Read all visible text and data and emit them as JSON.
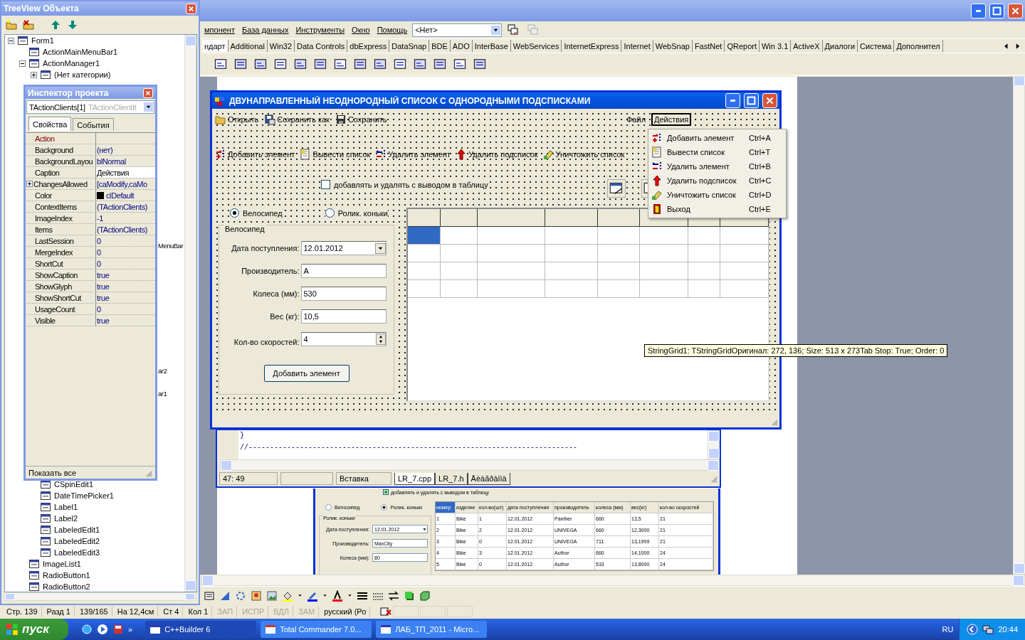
{
  "ide": {
    "menu": [
      "мпонент",
      "База данных",
      "Инструменты",
      "Окно",
      "Помощь"
    ],
    "target": "<Нет>",
    "palette_tabs": [
      {
        "label": "ндарт",
        "selected": true
      },
      {
        "label": "Additional",
        "selected": false
      },
      {
        "label": "Win32",
        "selected": false
      },
      {
        "label": "Data Controls",
        "selected": false
      },
      {
        "label": "dbExpress",
        "selected": false
      },
      {
        "label": "DataSnap",
        "selected": false
      },
      {
        "label": "BDE",
        "selected": false
      },
      {
        "label": "ADO",
        "selected": false
      },
      {
        "label": "InterBase",
        "selected": false
      },
      {
        "label": "WebServices",
        "selected": false
      },
      {
        "label": "InternetExpress",
        "selected": false
      },
      {
        "label": "Internet",
        "selected": false
      },
      {
        "label": "WebSnap",
        "selected": false
      },
      {
        "label": "FastNet",
        "selected": false
      },
      {
        "label": "QReport",
        "selected": false
      },
      {
        "label": "Win 3.1",
        "selected": false
      },
      {
        "label": "ActiveX",
        "selected": false
      },
      {
        "label": "Диалоги",
        "selected": false
      },
      {
        "label": "Система",
        "selected": false
      },
      {
        "label": "Дополнител",
        "selected": false
      }
    ]
  },
  "treeview": {
    "title": "TreeView Объекта",
    "items": [
      {
        "label": "Form1",
        "expanded": true,
        "children": [
          {
            "label": "ActionMainMenuBar1"
          },
          {
            "label": "ActionManager1",
            "expanded": true,
            "children": [
              {
                "label": "(Нет категории)",
                "expanded": false
              }
            ]
          },
          {
            "label": "MenuBar",
            "kind": "partial"
          },
          {
            "label": "ar2",
            "kind": "partial"
          },
          {
            "label": "ar1",
            "kind": "partial"
          },
          {
            "kind": "covered",
            "children": [
              {
                "label": "CSpinEdit1"
              },
              {
                "label": "DateTimePicker1"
              },
              {
                "label": "Label1"
              },
              {
                "label": "Label2"
              },
              {
                "label": "LabeledEdit1"
              },
              {
                "label": "LabeledEdit2"
              },
              {
                "label": "LabeledEdit3"
              }
            ]
          },
          {
            "label": "ImageList1"
          },
          {
            "label": "RadioButton1"
          },
          {
            "label": "RadioButton2"
          }
        ]
      }
    ]
  },
  "inspector": {
    "title": "Инспектор проекта",
    "object": "TActionClients[1]",
    "object_type": "TActionClientIt",
    "tabs": [
      {
        "label": "Свойства",
        "selected": true
      },
      {
        "label": "События",
        "selected": false
      }
    ],
    "properties": [
      {
        "name": "Action",
        "kind": "reference",
        "selected": false
      },
      {
        "name": "Background",
        "value": "(нет)",
        "kind": "plain",
        "selected": false
      },
      {
        "name": "BackgroundLayou",
        "value": "blNormal",
        "kind": "plain",
        "selected": false
      },
      {
        "name": "Caption",
        "value": "Действия",
        "kind": "plain",
        "selected": true
      },
      {
        "name": "ChangesAllowed",
        "value": "[caModify,caMo",
        "kind": "set",
        "selected": false
      },
      {
        "name": "Color",
        "value": "clDefault",
        "kind": "color",
        "selected": false
      },
      {
        "name": "ContextItems",
        "value": "(TActionClients)",
        "kind": "plain",
        "selected": false
      },
      {
        "name": "ImageIndex",
        "value": "-1",
        "kind": "plain",
        "selected": false
      },
      {
        "name": "Items",
        "value": "(TActionClients)",
        "kind": "plain",
        "selected": false
      },
      {
        "name": "LastSession",
        "value": "0",
        "kind": "plain",
        "selected": false
      },
      {
        "name": "MergeIndex",
        "value": "0",
        "kind": "plain",
        "selected": false
      },
      {
        "name": "ShortCut",
        "value": "0",
        "kind": "plain",
        "selected": false
      },
      {
        "name": "ShowCaption",
        "value": "true",
        "kind": "plain",
        "selected": false
      },
      {
        "name": "ShowGlyph",
        "value": "true",
        "kind": "plain",
        "selected": false
      },
      {
        "name": "ShowShortCut",
        "value": "true",
        "kind": "plain",
        "selected": false
      },
      {
        "name": "UsageCount",
        "value": "0",
        "kind": "plain",
        "selected": false
      },
      {
        "name": "Visible",
        "value": "true",
        "kind": "plain",
        "selected": false
      }
    ],
    "footer": "Показать все"
  },
  "editor": {
    "lines": [
      "}",
      "//-----------------------------------------------------------------------------"
    ],
    "position": "47:  49",
    "mode": "Вставка",
    "tabs": [
      {
        "label": "LR_7.cpp",
        "selected": true
      },
      {
        "label": "LR_7.h",
        "selected": false
      },
      {
        "label": "Äèàãðàììà",
        "selected": false
      }
    ]
  },
  "form": {
    "title": "ДВУНАПРАВЛЕННЫЙ  НЕОДНОРОДНЫЙ  СПИСОК  С  ОДНОРОДНЫМИ  ПОДСПИСКАМИ",
    "toolbar": [
      "Открыть",
      "Сохранить как",
      "Сохранить"
    ],
    "menus": [
      {
        "label": "Файл",
        "selected": false
      },
      {
        "label": "Действия",
        "selected": true
      }
    ],
    "actions": [
      "Добавить элемент",
      "Вывести список",
      "Удалить элемент",
      "Удалить подсписок",
      "Уничтожить список"
    ],
    "option": {
      "label": "добавлять и удалять с выводом в таблицу",
      "checked": false
    },
    "vehicles": [
      {
        "label": "Велосипед",
        "selected": true
      },
      {
        "label": "Ролик. коньки",
        "selected": false
      }
    ],
    "group": {
      "title": "Велосипед",
      "fields": [
        {
          "label": "Дата поступления:",
          "value": "12.01.2012",
          "kind": "date"
        },
        {
          "label": "Производитель:",
          "value": "A",
          "kind": "text"
        },
        {
          "label": "Колеса (мм):",
          "value": "530",
          "kind": "text"
        },
        {
          "label": "Вес (кг):",
          "value": "10,5",
          "kind": "text"
        },
        {
          "label": "Кол-во скоростей:",
          "value": "4",
          "kind": "spin"
        }
      ],
      "button": "Добавить элемент"
    },
    "grid": {
      "rows": [
        {
          "cells": [
            {
              "selected": true
            },
            {
              "selected": false
            },
            {
              "selected": false
            },
            {
              "selected": false
            },
            {
              "selected": false
            },
            {
              "selected": false
            },
            {
              "selected": false
            },
            {
              "selected": false
            }
          ]
        },
        {
          "cells": [
            {
              "selected": false
            },
            {
              "selected": false
            },
            {
              "selected": false
            },
            {
              "selected": false
            },
            {
              "selected": false
            },
            {
              "selected": false
            },
            {
              "selected": false
            },
            {
              "selected": false
            }
          ]
        },
        {
          "cells": [
            {
              "selected": false
            },
            {
              "selected": false
            },
            {
              "selected": false
            },
            {
              "selected": false
            },
            {
              "selected": false
            },
            {
              "selected": false
            },
            {
              "selected": false
            },
            {
              "selected": false
            }
          ]
        },
        {
          "cells": [
            {
              "selected": false
            },
            {
              "selected": false
            },
            {
              "selected": false
            },
            {
              "selected": false
            },
            {
              "selected": false
            },
            {
              "selected": false
            },
            {
              "selected": false
            },
            {
              "selected": false
            }
          ]
        }
      ]
    }
  },
  "menu_dropdown": [
    {
      "label": "Добавить элемент",
      "shortcut": "Ctrl+A"
    },
    {
      "label": "Вывести список",
      "shortcut": "Ctrl+T"
    },
    {
      "label": "Удалить элемент",
      "shortcut": "Ctrl+B"
    },
    {
      "label": "Удалить подсписок",
      "shortcut": "Ctrl+C"
    },
    {
      "label": "Уничтожить список",
      "shortcut": "Ctrl+D"
    },
    {
      "label": "Выход",
      "shortcut": "Ctrl+E"
    }
  ],
  "tooltip": "StringGrid1: TStringGridОригинал: 272, 136; Size: 513 x 273Tab Stop: True; Order: 0",
  "document": {
    "screenshot": {
      "option": {
        "label": "добавлять и удалять с выводом в таблицу",
        "checked": true
      },
      "vehicles": [
        {
          "label": "Велосипед",
          "selected": false
        },
        {
          "label": "Ролик. коньки",
          "selected": true
        }
      ],
      "group_title": "Ролик. коньки",
      "fields": [
        {
          "label": "Дата поступления:",
          "value": "12.01.2012",
          "kind": "date"
        },
        {
          "label": "Производитель:",
          "value": "MaxCity",
          "kind": "text"
        },
        {
          "label": "Колеса (мм):",
          "value": "80",
          "kind": "text"
        }
      ],
      "columns": [
        {
          "label": "номер",
          "selected": true
        },
        {
          "label": "изделие",
          "selected": false
        },
        {
          "label": "кол-во(шт)",
          "selected": false
        },
        {
          "label": "дата поступления",
          "selected": false
        },
        {
          "label": "производитель",
          "selected": false
        },
        {
          "label": "колеса (мм)",
          "selected": false
        },
        {
          "label": "вес(кг)",
          "selected": false
        },
        {
          "label": "кол-во скоростей",
          "selected": false
        }
      ],
      "rows": [
        [
          "1",
          "Bike",
          "1",
          "12.01.2012",
          "Panther",
          "660",
          "13,5",
          "21"
        ],
        [
          "2",
          "Bike",
          "2",
          "12.01.2012",
          "UNIVEGA",
          "660",
          "12,3000",
          "21"
        ],
        [
          "3",
          "Bike",
          "0",
          "12.01.2012",
          "UNIVEGA",
          "711",
          "13,1999",
          "21"
        ],
        [
          "4",
          "Bike",
          "3",
          "12.01.2012",
          "Author",
          "660",
          "14,1000",
          "24"
        ],
        [
          "5",
          "Bike",
          "0",
          "12.01.2012",
          "Author",
          "533",
          "13,8000",
          "24"
        ]
      ]
    }
  },
  "word_status": [
    {
      "label": "Стр. 139",
      "disabled": false
    },
    {
      "label": "Разд 1",
      "disabled": false
    },
    {
      "label": "139/165",
      "disabled": false
    },
    {
      "label": "На 12,4см",
      "disabled": false
    },
    {
      "label": "Ст 4",
      "disabled": false
    },
    {
      "label": "Кол 1",
      "disabled": false
    },
    {
      "label": "ЗАП",
      "disabled": true
    },
    {
      "label": "ИСПР",
      "disabled": true
    },
    {
      "label": "ВДЛ",
      "disabled": true
    },
    {
      "label": "ЗАМ",
      "disabled": true
    },
    {
      "label": "русский (Ро",
      "disabled": false
    }
  ],
  "taskbar": {
    "start": "пуск",
    "more": "»",
    "tasks": [
      {
        "label": "C++Builder 6",
        "selected": true
      },
      {
        "label": "Total Commander 7.0...",
        "selected": false
      },
      {
        "label": "ЛАБ_ТП_2011 - Micro...",
        "selected": false
      }
    ],
    "language": "RU",
    "clock": "20:44"
  }
}
